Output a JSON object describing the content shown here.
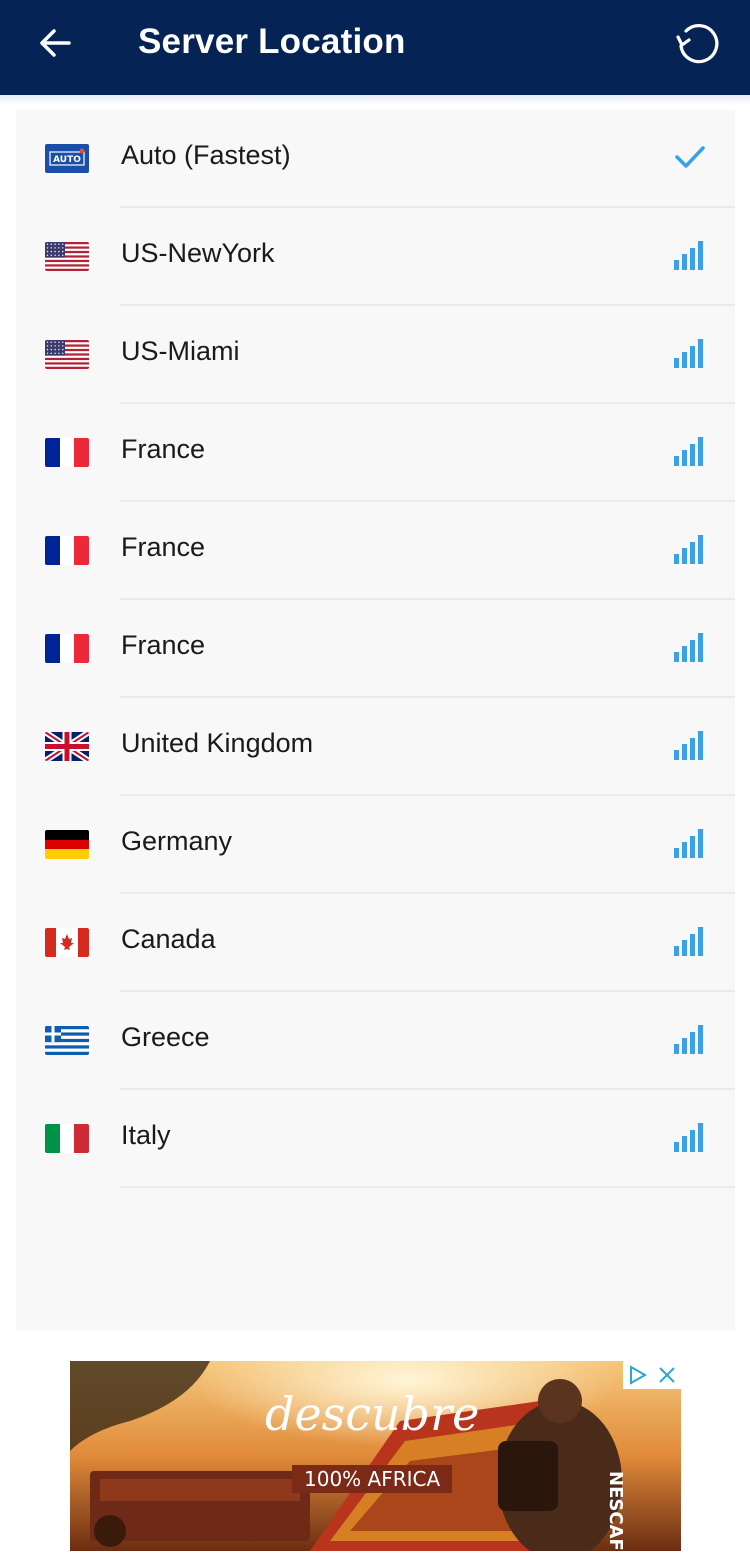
{
  "header": {
    "title": "Server Location",
    "back_icon": "arrow-left-icon",
    "refresh_icon": "refresh-icon",
    "background": "#052455"
  },
  "accent": "#3aa0e8",
  "servers": [
    {
      "label": "Auto (Fastest)",
      "flag": "auto",
      "status": "selected-check"
    },
    {
      "label": "US-NewYork",
      "flag": "us",
      "status": "signal-full"
    },
    {
      "label": "US-Miami",
      "flag": "us",
      "status": "signal-full"
    },
    {
      "label": "France",
      "flag": "fr",
      "status": "signal-full"
    },
    {
      "label": "France",
      "flag": "fr",
      "status": "signal-full"
    },
    {
      "label": "France",
      "flag": "fr",
      "status": "signal-full"
    },
    {
      "label": "United Kingdom",
      "flag": "uk",
      "status": "signal-full"
    },
    {
      "label": "Germany",
      "flag": "de",
      "status": "signal-full"
    },
    {
      "label": "Canada",
      "flag": "ca",
      "status": "signal-full"
    },
    {
      "label": "Greece",
      "flag": "gr",
      "status": "signal-full"
    },
    {
      "label": "Italy",
      "flag": "it",
      "status": "signal-full"
    }
  ],
  "auto_badge": "AUTO",
  "ad": {
    "headline": "descubre",
    "tagline": "100% AFRICA",
    "brand": "NESCAFÉ",
    "adchoices_icon": "adchoices-icon",
    "close_icon": "close-icon"
  }
}
